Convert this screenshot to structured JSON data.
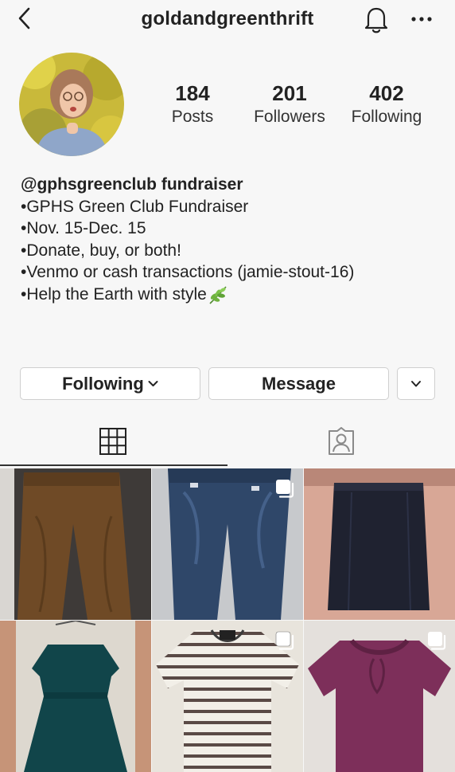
{
  "header": {
    "username": "goldandgreenthrift",
    "icons": {
      "back": "chevron-left-icon",
      "notifications": "bell-icon",
      "more": "more-horizontal-icon"
    }
  },
  "profile": {
    "stats": [
      {
        "count": "184",
        "label": "Posts"
      },
      {
        "count": "201",
        "label": "Followers"
      },
      {
        "count": "402",
        "label": "Following"
      }
    ],
    "bio": {
      "name": "@gphsgreenclub fundraiser",
      "lines": [
        "•GPHS Green Club Fundraiser",
        "•Nov. 15-Dec. 15",
        "•Donate, buy, or both!",
        "•Venmo or cash transactions (jamie-stout-16)",
        "•Help the Earth with style"
      ]
    }
  },
  "actions": {
    "following_label": "Following",
    "message_label": "Message"
  },
  "tabs": [
    {
      "icon": "grid-icon",
      "active": true
    },
    {
      "icon": "tagged-person-icon",
      "active": false
    }
  ],
  "posts": [
    {
      "subject": "brown pants",
      "multi": false
    },
    {
      "subject": "blue jeans",
      "multi": true
    },
    {
      "subject": "black skirt",
      "multi": false
    },
    {
      "subject": "teal dress",
      "multi": false
    },
    {
      "subject": "striped shirt",
      "multi": true
    },
    {
      "subject": "purple sweater",
      "multi": true
    }
  ],
  "colors": {
    "text": "#222222",
    "background": "#f7f7f7",
    "border": "#cfcfcf"
  }
}
